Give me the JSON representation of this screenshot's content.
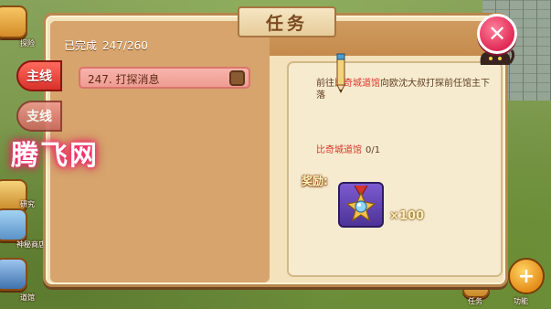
{
  "header": {
    "title": "任务",
    "progress_label": "已完成",
    "progress_value": "247/260"
  },
  "tabs": [
    {
      "label": "主线"
    },
    {
      "label": "支线"
    }
  ],
  "quests": [
    {
      "label": "247. 打探消息"
    }
  ],
  "detail": {
    "desc_prefix": "前往",
    "desc_place": "比奇城道馆",
    "desc_suffix": "向欧沈大叔打探前任馆主下落",
    "goal_name": "比奇城道馆",
    "goal_count": "0/1",
    "reward_label": "奖励:",
    "reward_qty": "×100"
  },
  "side_labels": {
    "top_left": "探险",
    "left_1": "研究",
    "left_2": "神秘商店",
    "left_3": "道馆",
    "bottom_mid": "任务",
    "bottom_right": "功能"
  },
  "watermark": "腾飞网"
}
